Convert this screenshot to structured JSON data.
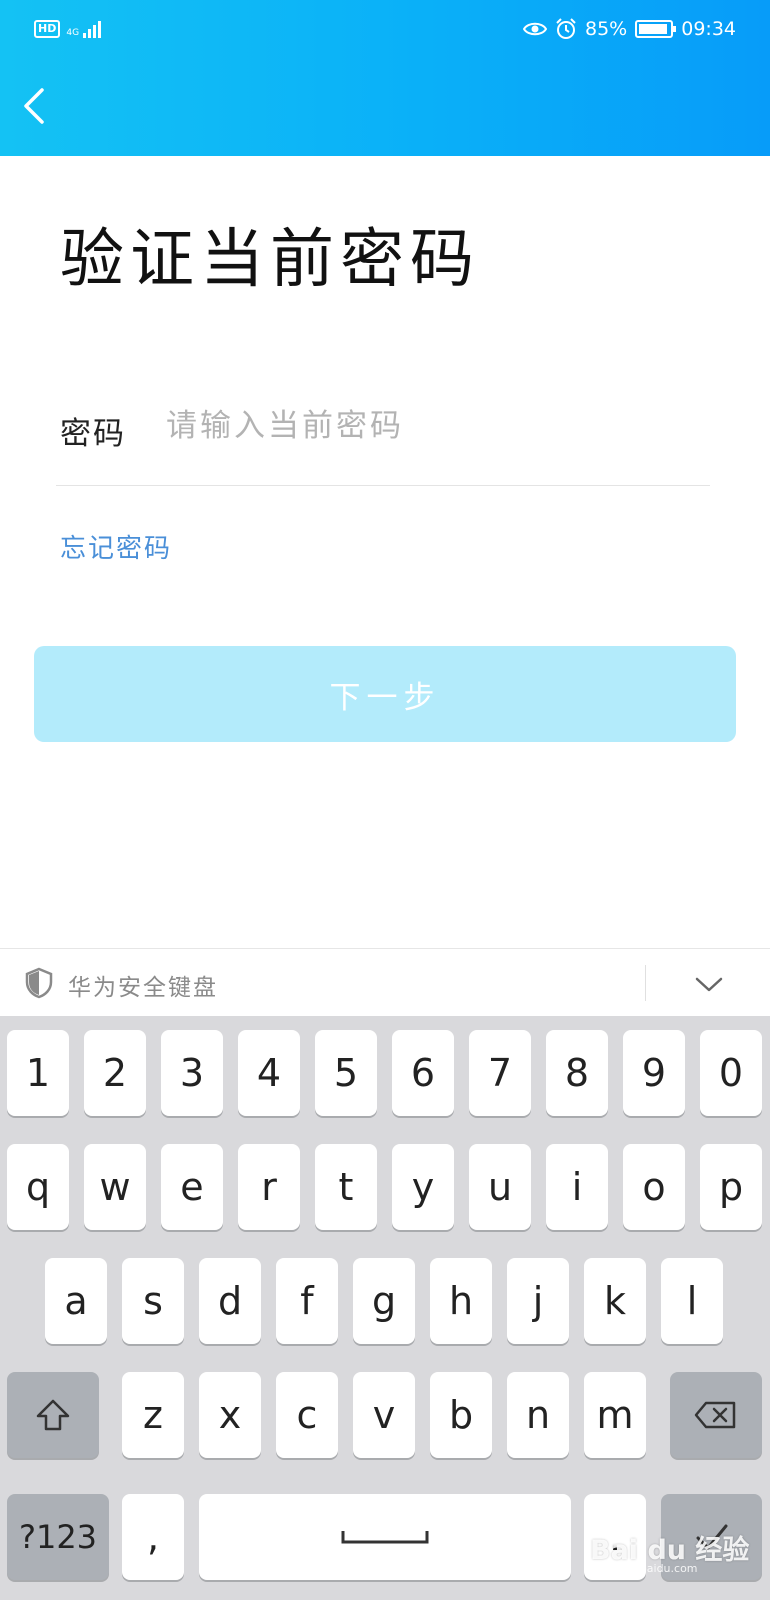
{
  "status_bar": {
    "hd": "HD",
    "network": "4G",
    "battery": "85%",
    "time": "09:34"
  },
  "nav": {
    "back_icon": "chevron-left-icon"
  },
  "page": {
    "title": "验证当前密码",
    "password_label": "密码",
    "password_placeholder": "请输入当前密码",
    "password_value": "",
    "forgot_link": "忘记密码",
    "next_button": "下一步"
  },
  "colors": {
    "header_start": "#14c2f4",
    "header_end": "#079cf9",
    "link": "#4a8fd8",
    "button_disabled": "#b3ebfb"
  },
  "keyboard": {
    "title": "华为安全键盘",
    "rows": {
      "numbers": [
        "1",
        "2",
        "3",
        "4",
        "5",
        "6",
        "7",
        "8",
        "9",
        "0"
      ],
      "row1": [
        "q",
        "w",
        "e",
        "r",
        "t",
        "y",
        "u",
        "i",
        "o",
        "p"
      ],
      "row2": [
        "a",
        "s",
        "d",
        "f",
        "g",
        "h",
        "j",
        "k",
        "l"
      ],
      "row3": [
        "z",
        "x",
        "c",
        "v",
        "b",
        "n",
        "m"
      ]
    },
    "symbols_key": "?123",
    "comma_key": ",",
    "period_key": "."
  },
  "watermark": {
    "text": "Bai du 经验",
    "url": "jingyan.baidu.com"
  }
}
